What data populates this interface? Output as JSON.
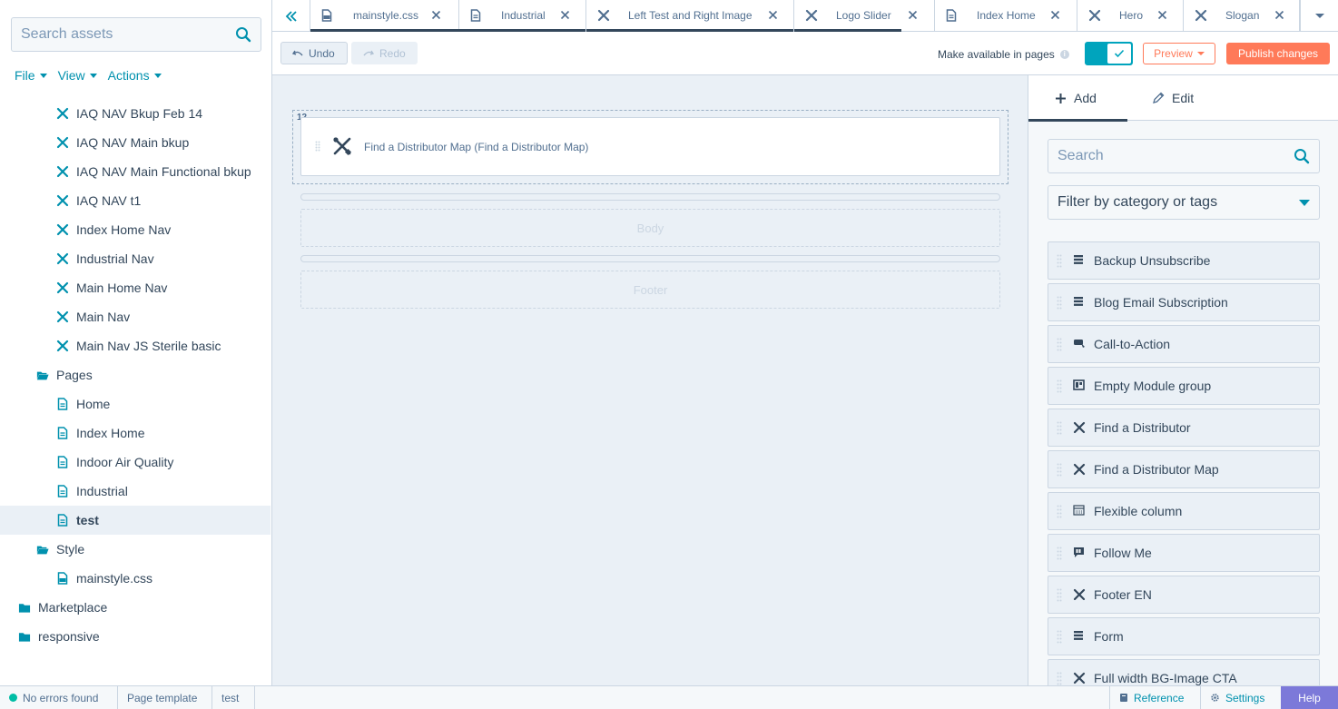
{
  "sidebar": {
    "search_placeholder": "Search assets",
    "menu": [
      {
        "label": "File"
      },
      {
        "label": "View"
      },
      {
        "label": "Actions"
      }
    ],
    "tree": [
      {
        "label": "IAQ NAV Bkup Feb 14",
        "icon": "module-icon",
        "level": 2
      },
      {
        "label": "IAQ NAV Main bkup",
        "icon": "module-icon",
        "level": 2
      },
      {
        "label": "IAQ NAV Main Functional bkup",
        "icon": "module-icon",
        "level": 2
      },
      {
        "label": "IAQ NAV t1",
        "icon": "module-icon",
        "level": 2
      },
      {
        "label": "Index Home Nav",
        "icon": "module-icon",
        "level": 2
      },
      {
        "label": "Industrial Nav",
        "icon": "module-icon",
        "level": 2
      },
      {
        "label": "Main Home Nav",
        "icon": "module-icon",
        "level": 2
      },
      {
        "label": "Main Nav",
        "icon": "module-icon",
        "level": 2
      },
      {
        "label": "Main Nav JS Sterile basic",
        "icon": "module-icon",
        "level": 2
      },
      {
        "label": "Pages",
        "icon": "folder-open-icon",
        "level": 1
      },
      {
        "label": "Home",
        "icon": "page-icon",
        "level": 2
      },
      {
        "label": "Index Home",
        "icon": "page-icon",
        "level": 2
      },
      {
        "label": "Indoor Air Quality",
        "icon": "page-icon",
        "level": 2
      },
      {
        "label": "Industrial",
        "icon": "page-icon",
        "level": 2
      },
      {
        "label": "test",
        "icon": "page-icon",
        "level": 2,
        "selected": true
      },
      {
        "label": "Style",
        "icon": "folder-open-icon",
        "level": 1
      },
      {
        "label": "mainstyle.css",
        "icon": "css-file-icon",
        "level": 2
      },
      {
        "label": "Marketplace",
        "icon": "folder-icon",
        "level": 0
      },
      {
        "label": "responsive",
        "icon": "folder-icon",
        "level": 0
      }
    ]
  },
  "tabs": [
    {
      "label": "mainstyle.css",
      "icon": "css-file-icon",
      "active": true
    },
    {
      "label": "Industrial",
      "icon": "page-icon"
    },
    {
      "label": "Left Test and Right Image",
      "icon": "module-icon"
    },
    {
      "label": "Logo Slider",
      "icon": "module-icon"
    },
    {
      "label": "Index Home",
      "icon": "page-icon"
    },
    {
      "label": "Hero",
      "icon": "module-icon"
    },
    {
      "label": "Slogan",
      "icon": "module-icon"
    }
  ],
  "toolbar": {
    "undo_label": "Undo",
    "redo_label": "Redo",
    "available_label": "Make available in pages",
    "available_enabled": true,
    "preview_label": "Preview",
    "publish_label": "Publish changes"
  },
  "canvas": {
    "row_number": "12",
    "module_label": "Find a Distributor Map (Find a Distributor Map)",
    "body_label": "Body",
    "footer_label": "Footer"
  },
  "panel": {
    "tab_add": "Add",
    "tab_edit": "Edit",
    "search_placeholder": "Search",
    "filter_label": "Filter by category or tags",
    "modules": [
      {
        "label": "Backup Unsubscribe",
        "icon": "stack-icon"
      },
      {
        "label": "Blog Email Subscription",
        "icon": "stack-icon"
      },
      {
        "label": "Call-to-Action",
        "icon": "cta-icon"
      },
      {
        "label": "Empty Module group",
        "icon": "module-group-icon"
      },
      {
        "label": "Find a Distributor",
        "icon": "module-icon"
      },
      {
        "label": "Find a Distributor Map",
        "icon": "module-icon"
      },
      {
        "label": "Flexible column",
        "icon": "flexible-column-icon"
      },
      {
        "label": "Follow Me",
        "icon": "follow-me-icon"
      },
      {
        "label": "Footer EN",
        "icon": "module-icon"
      },
      {
        "label": "Form",
        "icon": "stack-icon"
      },
      {
        "label": "Full width BG-Image CTA",
        "icon": "module-icon"
      }
    ]
  },
  "statusbar": {
    "errors_label": "No errors found",
    "template_type": "Page template",
    "template_name": "test",
    "reference_label": "Reference",
    "settings_label": "Settings",
    "help_label": "Help"
  },
  "colors": {
    "accent": "#0091ae",
    "toggle": "#00a4bd",
    "publish": "#ff7a59",
    "help": "#7c79d9",
    "status_ok": "#00bda5"
  }
}
